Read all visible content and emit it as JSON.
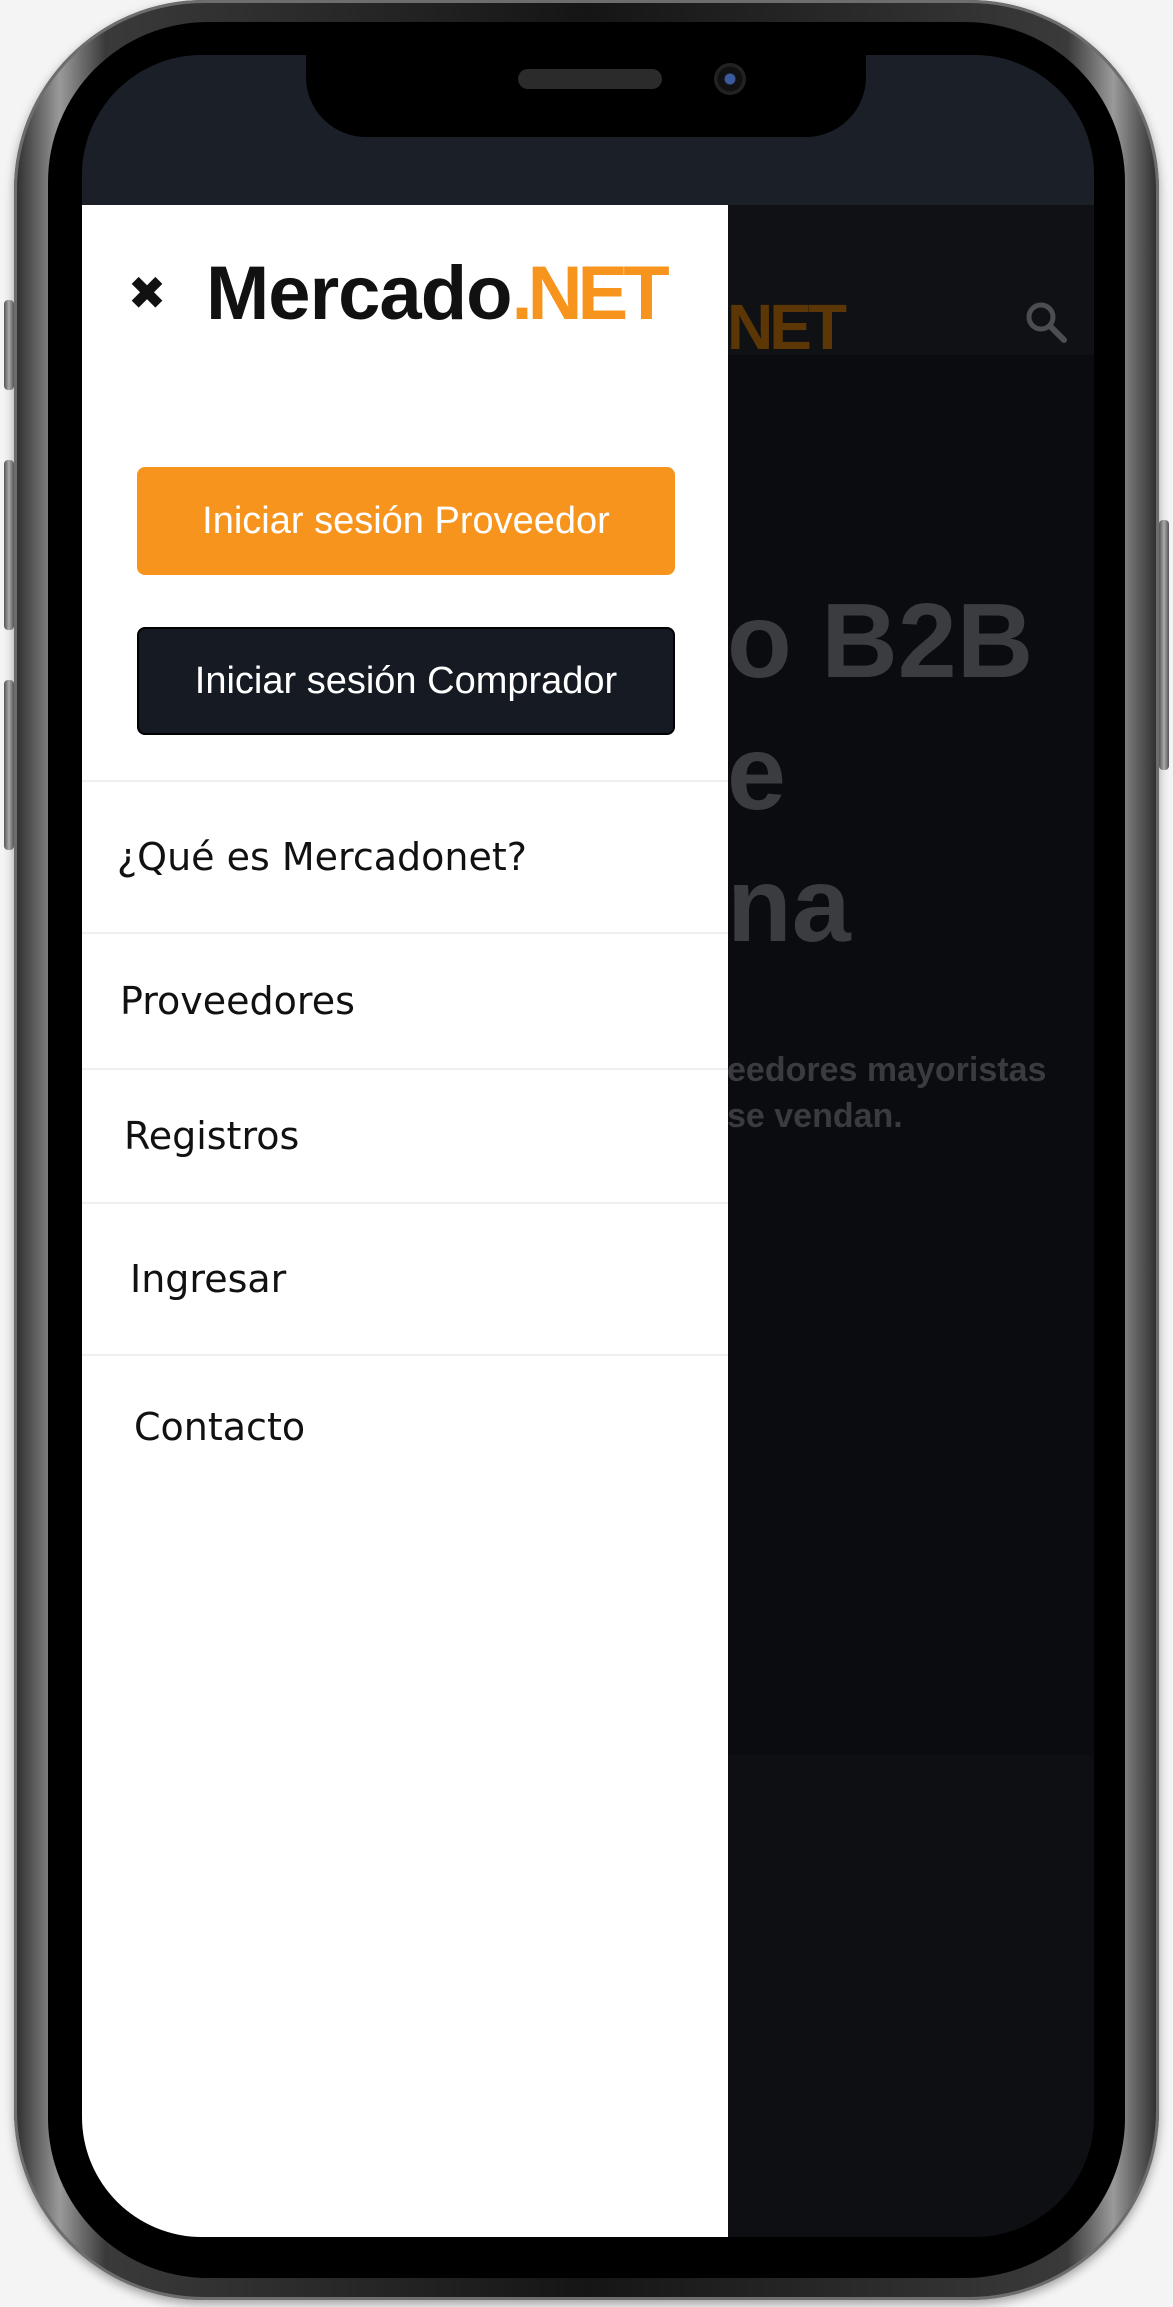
{
  "drawer": {
    "close_icon": "close-icon",
    "logo_main": "Mercado",
    "logo_accent": ".NET",
    "button_provider": "Iniciar sesión Proveedor",
    "button_buyer": "Iniciar sesión Comprador",
    "menu": [
      {
        "label": "¿Qué es Mercadonet?"
      },
      {
        "label": "Proveedores"
      },
      {
        "label": "Registros"
      },
      {
        "label": "Ingresar"
      },
      {
        "label": "Contacto"
      }
    ]
  },
  "background_page": {
    "logo_fragment": "NET",
    "search_icon": "search-icon",
    "hero_title_lines": [
      "o B2B",
      "e",
      "na"
    ],
    "hero_subtitle_lines": [
      "eedores mayoristas",
      "se vendan."
    ]
  },
  "colors": {
    "brand_orange": "#f7941d",
    "buyer_button": "#151a23",
    "overlay_dark": "#0d0f12"
  }
}
